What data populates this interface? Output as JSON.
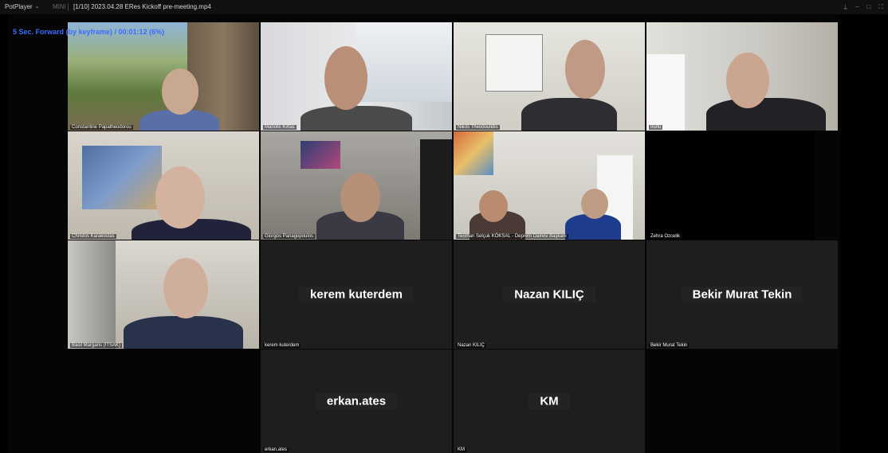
{
  "titlebar": {
    "app_name": "PotPlayer",
    "mini_label": "MINI",
    "file_title": "[1/10] 2023.04.28 ERes Kickoff pre-meeting.mp4",
    "controls": [
      "pin-icon",
      "minimize-icon",
      "maximize-icon",
      "fullscreen-icon"
    ]
  },
  "osd": {
    "text": "5 Sec. Forward (by keyframe) / 00:01:12 (6%)"
  },
  "participants": [
    {
      "name": "Constantine Papatheodorou",
      "video": true
    },
    {
      "name": "Manolis Kirtas",
      "video": true
    },
    {
      "name": "Nikos Theodoulidis",
      "video": true
    },
    {
      "name": "nurlu",
      "video": true
    },
    {
      "name": "Christos Karakostas",
      "video": true
    },
    {
      "name": "Giorgos Panagopoulos",
      "video": true
    },
    {
      "name": "Teoman Selçuk KÖKSAL - Deprem Dairesi Başkanı",
      "video": true
    },
    {
      "name": "Zehra Ozcelik",
      "video": false,
      "display": ""
    },
    {
      "name": "Basil Margaris (ITSAK)",
      "video": true
    },
    {
      "name": "kerem kuterdem",
      "video": false,
      "display": "kerem kuterdem"
    },
    {
      "name": "Nazan KILIÇ",
      "video": false,
      "display": "Nazan KILIÇ"
    },
    {
      "name": "Bekir Murat Tekin",
      "video": false,
      "display": "Bekir Murat Tekin"
    },
    {
      "name": "erkan.ates",
      "video": false,
      "display": "erkan.ates"
    },
    {
      "name": "KM",
      "video": false,
      "display": "KM"
    }
  ],
  "colors": {
    "osd": "#3d6bff",
    "tile_bg": "#1e1e1e",
    "titlebar_bg": "#101010"
  }
}
